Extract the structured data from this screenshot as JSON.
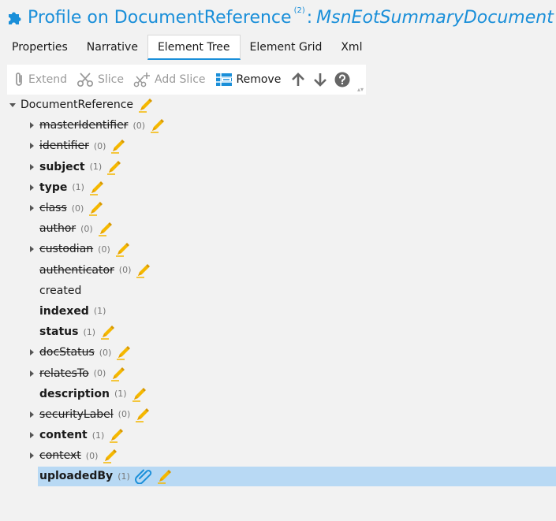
{
  "title": {
    "main": "Profile on DocumentReference",
    "sup": "(2)",
    "colon": ":",
    "name": "MsnEotSummaryDocument"
  },
  "tabs": [
    {
      "label": "Properties",
      "active": false
    },
    {
      "label": "Narrative",
      "active": false
    },
    {
      "label": "Element Tree",
      "active": true
    },
    {
      "label": "Element Grid",
      "active": false
    },
    {
      "label": "Xml",
      "active": false
    }
  ],
  "toolbar": {
    "extend": "Extend",
    "slice": "Slice",
    "add_slice": "Add Slice",
    "remove": "Remove"
  },
  "colors": {
    "accent": "#1a8fd9",
    "selection": "#b8d9f4",
    "pen": "#f5b800"
  },
  "tree": {
    "root": {
      "label": "DocumentReference",
      "expanded": true,
      "icon": "edit-pen-icon"
    },
    "items": [
      {
        "label": "masterIdentifier",
        "count": "(0)",
        "expander": true,
        "bold": false,
        "strike": true,
        "pen": true,
        "clip": false,
        "selected": false
      },
      {
        "label": "identifier",
        "count": "(0)",
        "expander": true,
        "bold": false,
        "strike": true,
        "pen": true,
        "clip": false,
        "selected": false
      },
      {
        "label": "subject",
        "count": "(1)",
        "expander": true,
        "bold": true,
        "strike": false,
        "pen": true,
        "clip": false,
        "selected": false
      },
      {
        "label": "type",
        "count": "(1)",
        "expander": true,
        "bold": true,
        "strike": false,
        "pen": true,
        "clip": false,
        "selected": false
      },
      {
        "label": "class",
        "count": "(0)",
        "expander": true,
        "bold": false,
        "strike": true,
        "pen": true,
        "clip": false,
        "selected": false
      },
      {
        "label": "author",
        "count": "(0)",
        "expander": false,
        "bold": false,
        "strike": true,
        "pen": true,
        "clip": false,
        "selected": false
      },
      {
        "label": "custodian",
        "count": "(0)",
        "expander": true,
        "bold": false,
        "strike": true,
        "pen": true,
        "clip": false,
        "selected": false
      },
      {
        "label": "authenticator",
        "count": "(0)",
        "expander": false,
        "bold": false,
        "strike": true,
        "pen": true,
        "clip": false,
        "selected": false
      },
      {
        "label": "created",
        "count": "",
        "expander": false,
        "bold": false,
        "strike": false,
        "pen": false,
        "clip": false,
        "selected": false
      },
      {
        "label": "indexed",
        "count": "(1)",
        "expander": false,
        "bold": true,
        "strike": false,
        "pen": false,
        "clip": false,
        "selected": false
      },
      {
        "label": "status",
        "count": "(1)",
        "expander": false,
        "bold": true,
        "strike": false,
        "pen": true,
        "clip": false,
        "selected": false
      },
      {
        "label": "docStatus",
        "count": "(0)",
        "expander": true,
        "bold": false,
        "strike": true,
        "pen": true,
        "clip": false,
        "selected": false
      },
      {
        "label": "relatesTo",
        "count": "(0)",
        "expander": true,
        "bold": false,
        "strike": true,
        "pen": true,
        "clip": false,
        "selected": false
      },
      {
        "label": "description",
        "count": "(1)",
        "expander": false,
        "bold": true,
        "strike": false,
        "pen": true,
        "clip": false,
        "selected": false
      },
      {
        "label": "securityLabel",
        "count": "(0)",
        "expander": true,
        "bold": false,
        "strike": true,
        "pen": true,
        "clip": false,
        "selected": false
      },
      {
        "label": "content",
        "count": "(1)",
        "expander": true,
        "bold": true,
        "strike": false,
        "pen": true,
        "clip": false,
        "selected": false
      },
      {
        "label": "context",
        "count": "(0)",
        "expander": true,
        "bold": false,
        "strike": true,
        "pen": true,
        "clip": false,
        "selected": false
      },
      {
        "label": "uploadedBy",
        "count": "(1)",
        "expander": false,
        "bold": true,
        "strike": false,
        "pen": true,
        "clip": true,
        "selected": true
      }
    ]
  }
}
